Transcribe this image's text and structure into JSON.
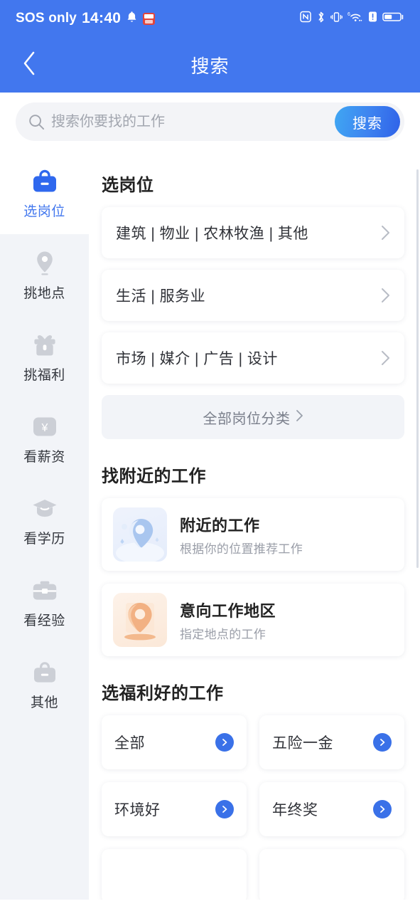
{
  "status_bar": {
    "carrier": "SOS only",
    "time": "14:40",
    "icons": [
      "bell-icon",
      "calendar-app-icon",
      "nfc-icon",
      "bluetooth-icon",
      "vibrate-icon",
      "wifi-6-icon",
      "alert-icon",
      "battery-icon"
    ]
  },
  "nav": {
    "title": "搜索",
    "back_icon": "chevron-left-icon"
  },
  "search": {
    "placeholder": "搜索你要找的工作",
    "value": "",
    "button_label": "搜索",
    "icon": "search-icon"
  },
  "sidebar": {
    "items": [
      {
        "label": "选岗位",
        "icon": "briefcase-icon",
        "active": true
      },
      {
        "label": "挑地点",
        "icon": "location-pin-icon",
        "active": false
      },
      {
        "label": "挑福利",
        "icon": "gift-icon",
        "active": false
      },
      {
        "label": "看薪资",
        "icon": "yuan-badge-icon",
        "active": false
      },
      {
        "label": "看学历",
        "icon": "graduation-cap-icon",
        "active": false
      },
      {
        "label": "看经验",
        "icon": "toolbox-icon",
        "active": false
      },
      {
        "label": "其他",
        "icon": "bag-icon",
        "active": false
      }
    ]
  },
  "main": {
    "job_section": {
      "title": "选岗位",
      "categories": [
        {
          "label": "建筑 | 物业 | 农林牧渔 | 其他"
        },
        {
          "label": "生活 | 服务业"
        },
        {
          "label": "市场 | 媒介 | 广告 | 设计"
        }
      ],
      "all_categories_label": "全部岗位分类"
    },
    "nearby_section": {
      "title": "找附近的工作",
      "cards": [
        {
          "title": "附近的工作",
          "subtitle": "根据你的位置推荐工作",
          "thumb": "blue-location-illustration"
        },
        {
          "title": "意向工作地区",
          "subtitle": "指定地点的工作",
          "thumb": "orange-location-illustration"
        }
      ]
    },
    "benefits_section": {
      "title": "选福利好的工作",
      "items": [
        {
          "label": "全部"
        },
        {
          "label": "五险一金"
        },
        {
          "label": "环境好"
        },
        {
          "label": "年终奖"
        },
        {
          "label": ""
        },
        {
          "label": ""
        }
      ]
    }
  },
  "colors": {
    "brand_blue": "#4277ee",
    "accent_blue": "#3a71e8",
    "sidebar_bg": "#f2f4f8",
    "page_bg": "#ffffff",
    "muted_text": "#9a9ea8"
  }
}
